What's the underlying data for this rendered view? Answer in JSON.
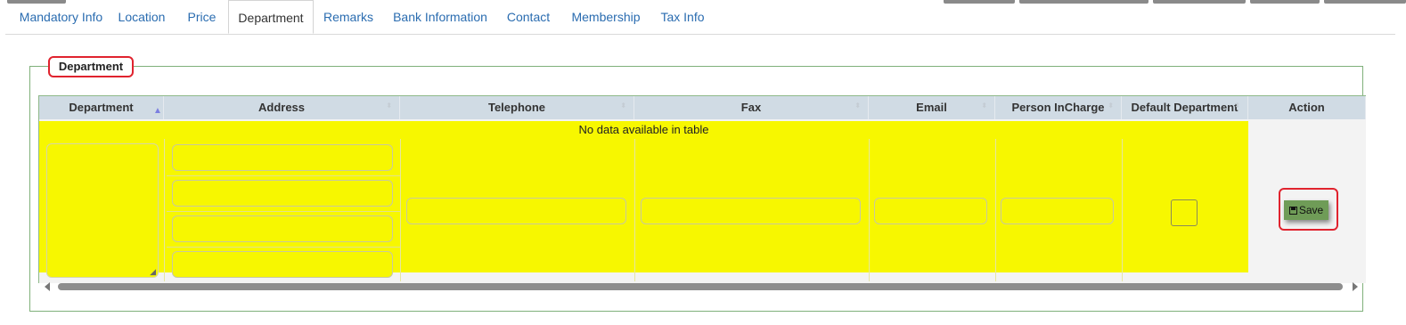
{
  "tabs": [
    {
      "label": "Mandatory Info"
    },
    {
      "label": "Location"
    },
    {
      "label": "Price"
    },
    {
      "label": "Department",
      "active": true
    },
    {
      "label": "Remarks"
    },
    {
      "label": "Bank Information"
    },
    {
      "label": "Contact"
    },
    {
      "label": "Membership"
    },
    {
      "label": "Tax Info"
    }
  ],
  "section": {
    "legend": "Department"
  },
  "table": {
    "columns": [
      "Department",
      "Address",
      "Telephone",
      "Fax",
      "Email",
      "Person InCharge",
      "Default Department",
      "Action"
    ],
    "sorted_column": "Department",
    "sort_direction": "ascending",
    "empty_message": "No data available in table"
  },
  "form_row": {
    "department": "",
    "address_lines": [
      "",
      "",
      "",
      ""
    ],
    "telephone": "",
    "fax": "",
    "email": "",
    "person_incharge": "",
    "default_department": false,
    "save_label": "Save"
  },
  "colors": {
    "tab_link": "#2a6cb0",
    "highlight": "#f7f700",
    "header_bg": "#d0dbe4",
    "save_button": "#6f9c57",
    "focus_outline": "#e0232e",
    "fieldset_border": "#7fb07a"
  }
}
